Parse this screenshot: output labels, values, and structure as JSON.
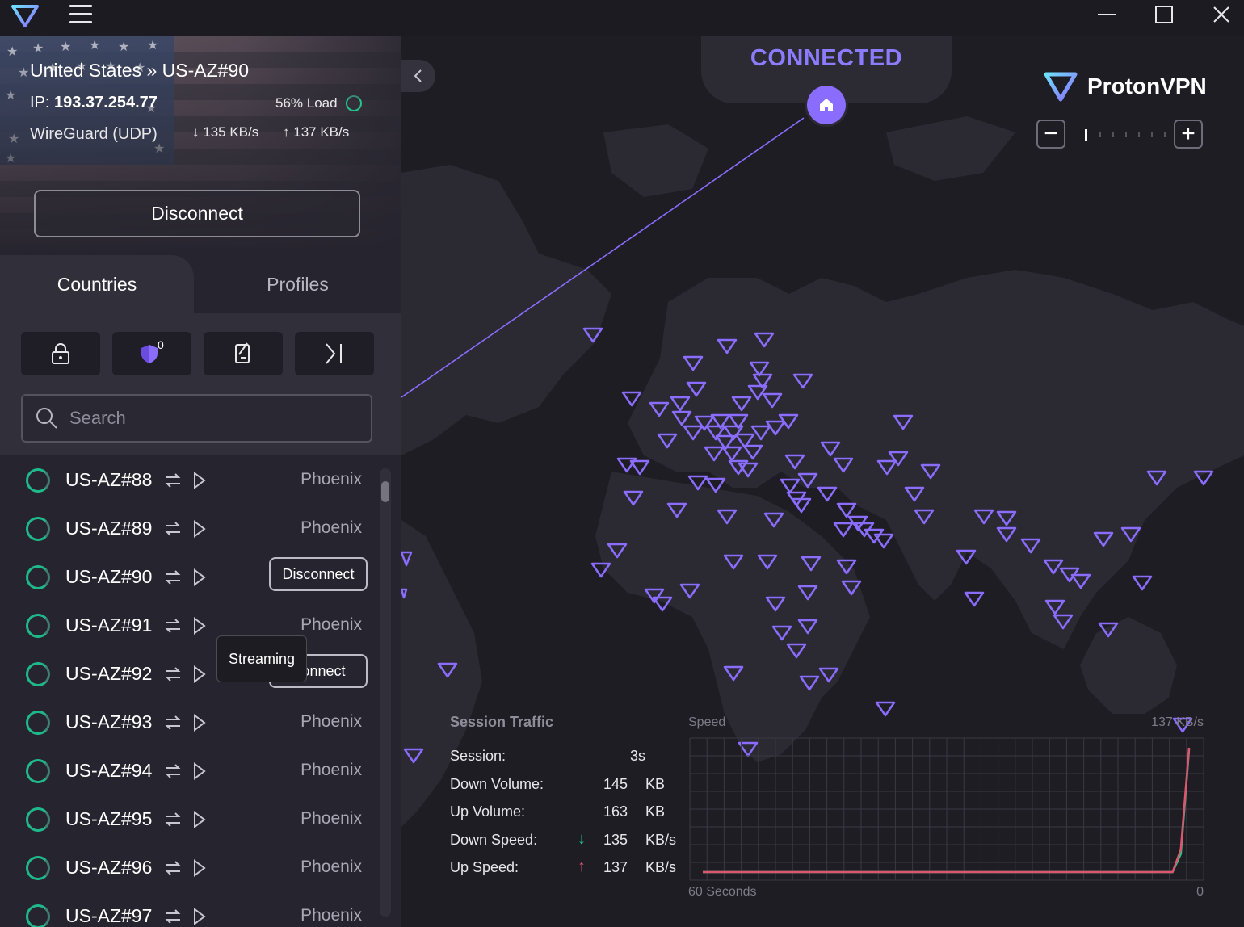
{
  "connection": {
    "title": "United States » US-AZ#90",
    "ip_label": "IP:",
    "ip": "193.37.254.77",
    "load": "56% Load",
    "protocol": "WireGuard (UDP)",
    "down_speed": "135 KB/s",
    "up_speed": "137 KB/s",
    "disconnect_label": "Disconnect"
  },
  "tabs": [
    "Countries",
    "Profiles"
  ],
  "filters": {
    "secure_core": "lock-icon",
    "netshield": "shield-icon",
    "netshield_count": "0",
    "kill_switch": "kill-switch-icon",
    "port_forward": "split-tunnel-icon"
  },
  "search": {
    "placeholder": "Search"
  },
  "servers": [
    {
      "name": "US-AZ#88",
      "city": "Phoenix",
      "button": ""
    },
    {
      "name": "US-AZ#89",
      "city": "Phoenix",
      "button": ""
    },
    {
      "name": "US-AZ#90",
      "city": "",
      "button": "Disconnect"
    },
    {
      "name": "US-AZ#91",
      "city": "Phoenix",
      "button": ""
    },
    {
      "name": "US-AZ#92",
      "city": "",
      "button": "Connect"
    },
    {
      "name": "US-AZ#93",
      "city": "Phoenix",
      "button": ""
    },
    {
      "name": "US-AZ#94",
      "city": "Phoenix",
      "button": ""
    },
    {
      "name": "US-AZ#95",
      "city": "Phoenix",
      "button": ""
    },
    {
      "name": "US-AZ#96",
      "city": "Phoenix",
      "button": ""
    },
    {
      "name": "US-AZ#97",
      "city": "Phoenix",
      "button": ""
    }
  ],
  "tooltip": "Streaming",
  "map": {
    "status": "CONNECTED",
    "brand": "ProtonVPN",
    "zoom_minus": "−",
    "zoom_plus": "+",
    "accent": "#8b7bff"
  },
  "session_traffic": {
    "header": "Session Traffic",
    "rows": [
      {
        "label": "Session:",
        "arrow": "",
        "value": "3s",
        "unit": ""
      },
      {
        "label": "Down Volume:",
        "arrow": "",
        "value": "145",
        "unit": "KB"
      },
      {
        "label": "Up Volume:",
        "arrow": "",
        "value": "163",
        "unit": "KB"
      },
      {
        "label": "Down Speed:",
        "arrow": "↓",
        "value": "135",
        "unit": "KB/s"
      },
      {
        "label": "Up Speed:",
        "arrow": "↑",
        "value": "137",
        "unit": "KB/s"
      }
    ]
  },
  "speed_chart": {
    "label": "Speed",
    "max_label": "137 KB/s",
    "x_start_label": "60 Seconds",
    "x_end_label": "0",
    "chart_data": {
      "type": "line",
      "series": [
        {
          "name": "down",
          "color": "#21c68c",
          "values": [
            0,
            0,
            0,
            0,
            0,
            0,
            0,
            0,
            0,
            0,
            0,
            0,
            0,
            0,
            0,
            0,
            0,
            0,
            0,
            0,
            0,
            0,
            0,
            0,
            0,
            0,
            0,
            0,
            0,
            0,
            0,
            0,
            0,
            0,
            0,
            0,
            0,
            0,
            0,
            0,
            0,
            0,
            0,
            0,
            0,
            0,
            0,
            0,
            0,
            0,
            0,
            0,
            0,
            0,
            0,
            0,
            0,
            0,
            20,
            135
          ]
        },
        {
          "name": "up",
          "color": "#e0556e",
          "values": [
            0,
            0,
            0,
            0,
            0,
            0,
            0,
            0,
            0,
            0,
            0,
            0,
            0,
            0,
            0,
            0,
            0,
            0,
            0,
            0,
            0,
            0,
            0,
            0,
            0,
            0,
            0,
            0,
            0,
            0,
            0,
            0,
            0,
            0,
            0,
            0,
            0,
            0,
            0,
            0,
            0,
            0,
            0,
            0,
            0,
            0,
            0,
            0,
            0,
            0,
            0,
            0,
            0,
            0,
            0,
            0,
            0,
            0,
            25,
            137
          ]
        }
      ],
      "ylim": [
        0,
        137
      ]
    }
  }
}
